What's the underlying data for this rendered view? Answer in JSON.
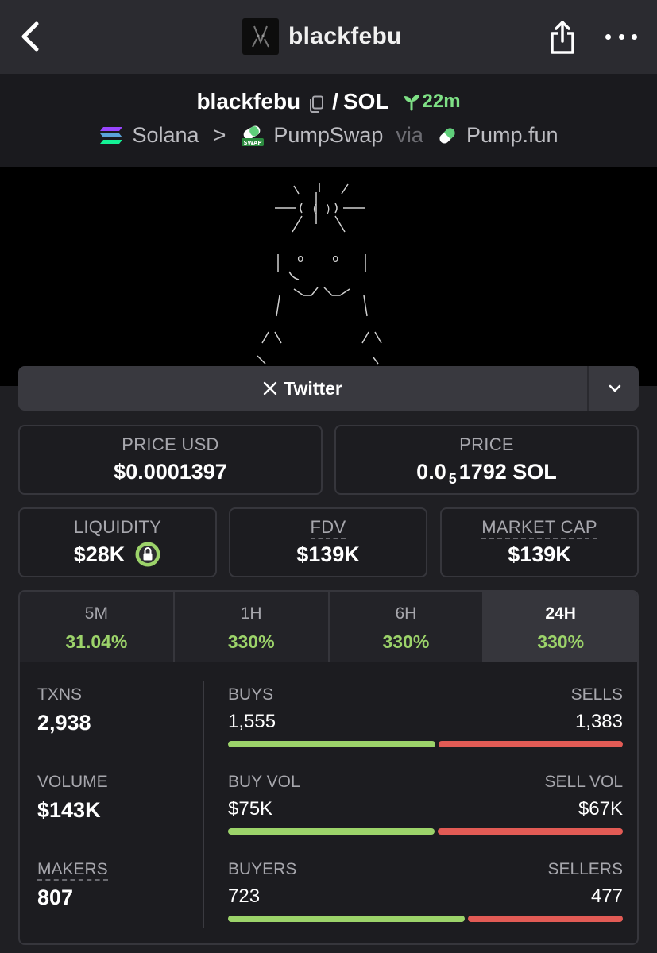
{
  "header": {
    "title": "blackfebu",
    "icons": [
      "back-arrow-icon",
      "share-icon",
      "more-icon"
    ]
  },
  "pair": {
    "base": "blackfebu",
    "separator": "/",
    "quote": "SOL",
    "age": "22m",
    "chain": "Solana",
    "arrow": ">",
    "dex": "PumpSwap",
    "via": "via",
    "launchpad": "Pump.fun"
  },
  "socials": {
    "twitter_label": "Twitter"
  },
  "price": {
    "usd_label": "PRICE USD",
    "usd_value": "$0.0001397",
    "native_label": "PRICE",
    "native_prefix": "0.0",
    "native_zeros": "5",
    "native_digits": "1792 SOL"
  },
  "metrics": {
    "liquidity_label": "LIQUIDITY",
    "liquidity_value": "$28K",
    "fdv_label": "FDV",
    "fdv_value": "$139K",
    "mcap_label": "MARKET CAP",
    "mcap_value": "$139K"
  },
  "periods": [
    {
      "label": "5M",
      "change": "31.04%"
    },
    {
      "label": "1H",
      "change": "330%"
    },
    {
      "label": "6H",
      "change": "330%"
    },
    {
      "label": "24H",
      "change": "330%"
    }
  ],
  "stats": {
    "txns_label": "TXNS",
    "txns_value": "2,938",
    "volume_label": "VOLUME",
    "volume_value": "$143K",
    "makers_label": "MAKERS",
    "makers_value": "807",
    "buys_label": "BUYS",
    "buys_value": "1,555",
    "sells_label": "SELLS",
    "sells_value": "1,383",
    "buys_ratio": 0.529,
    "buyvol_label": "BUY VOL",
    "buyvol_value": "$75K",
    "sellvol_label": "SELL VOL",
    "sellvol_value": "$67K",
    "buyvol_ratio": 0.528,
    "buyers_label": "BUYERS",
    "buyers_value": "723",
    "sellers_label": "SELLERS",
    "sellers_value": "477",
    "buyers_ratio": 0.603
  },
  "colors": {
    "positive": "#9cd36a",
    "negative": "#e25b55",
    "age": "#7ee085"
  }
}
